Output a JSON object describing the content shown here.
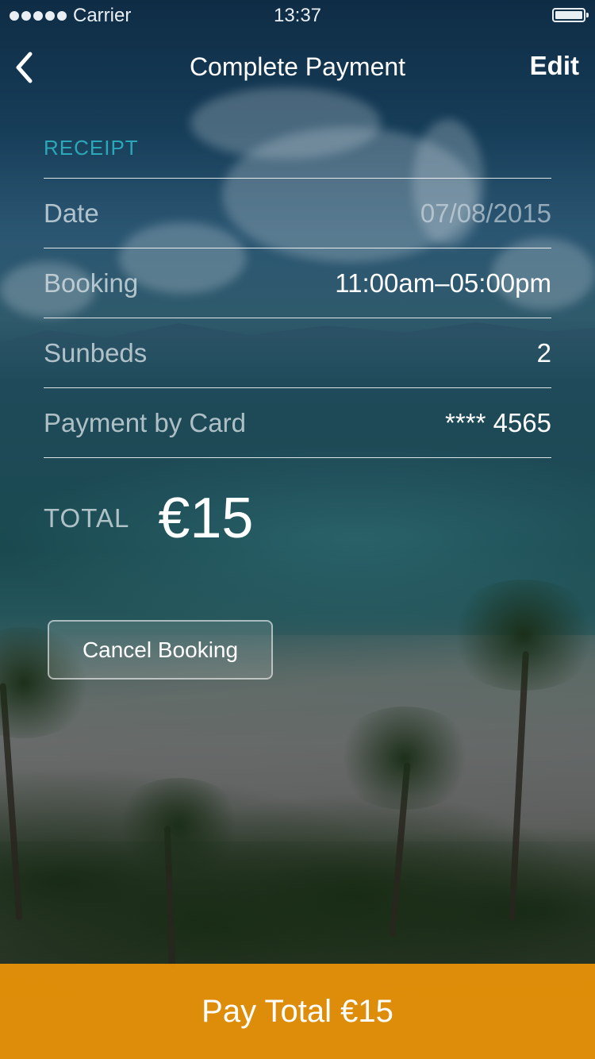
{
  "status_bar": {
    "carrier": "Carrier",
    "time": "13:37"
  },
  "nav": {
    "title": "Complete Payment",
    "edit_label": "Edit",
    "back_icon": "chevron-left-icon"
  },
  "receipt": {
    "heading": "RECEIPT",
    "rows": [
      {
        "label": "Date",
        "value": "07/08/2015"
      },
      {
        "label": "Booking",
        "value": "11:00am–05:00pm"
      },
      {
        "label": "Sunbeds",
        "value": "2"
      },
      {
        "label": "Payment by Card",
        "value": "**** 4565"
      }
    ],
    "total_label": "TOTAL",
    "total_amount": "€15"
  },
  "actions": {
    "cancel_label": "Cancel Booking",
    "pay_label": "Pay Total €15"
  },
  "colors": {
    "accent_teal": "#2aa8b8",
    "pay_orange": "#ec9408"
  }
}
